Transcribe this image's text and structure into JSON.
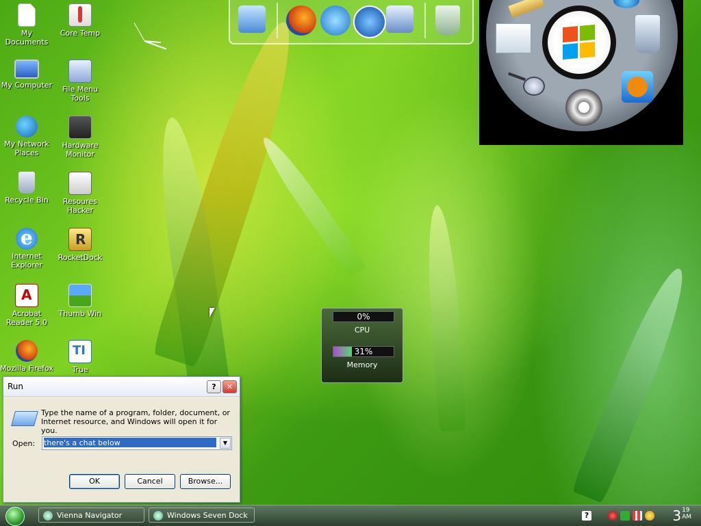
{
  "desktop": {
    "icons": [
      {
        "label": "My Documents"
      },
      {
        "label": "Core Temp"
      },
      {
        "label": "My Computer"
      },
      {
        "label": "File Menu Tools"
      },
      {
        "label": "My Network Places"
      },
      {
        "label": "Hardware Monitor"
      },
      {
        "label": "Recycle Bin"
      },
      {
        "label": "Resoures Hacker"
      },
      {
        "label": "Internet Explorer"
      },
      {
        "label": "RocketDock"
      },
      {
        "label": "Acrobat Reader 5.0"
      },
      {
        "label": "Thumb Win"
      },
      {
        "label": "Mozilla Firefox"
      },
      {
        "label": "True Transparency"
      }
    ]
  },
  "top_dock": {
    "items": [
      "monitor-icon",
      "firefox-icon",
      "internet-explorer-icon",
      "media-player-icon",
      "control-panel-icon",
      "recycle-bin-icon"
    ]
  },
  "radial_dock": {
    "center": "windows-logo-icon",
    "items": [
      "folder-icon",
      "globe-icon",
      "recycle-bin-icon",
      "media-player-icon",
      "film-reel-icon",
      "magnifier-icon",
      "notes-icon"
    ]
  },
  "meter": {
    "cpu_value": "0%",
    "cpu_label": "CPU",
    "cpu_fraction": 0.0,
    "memory_value": "31%",
    "memory_label": "Memory",
    "memory_fraction": 0.31
  },
  "run_dialog": {
    "title": "Run",
    "help_button": "?",
    "description": "Type the name of a program, folder, document, or Internet resource, and Windows will open it for you.",
    "open_label": "Open:",
    "open_value": "there's a chat below",
    "ok": "OK",
    "cancel": "Cancel",
    "browse": "Browse..."
  },
  "taskbar": {
    "tasks": [
      {
        "label": "Vienna Navigator"
      },
      {
        "label": "Windows Seven Dock"
      }
    ],
    "clock_hour": "3",
    "clock_minutes": "19",
    "clock_ampm": "AM"
  },
  "colors": {
    "accent": "#316ac5",
    "taskbar": "#3a4c3a",
    "desktop_green": "#4aa914"
  }
}
